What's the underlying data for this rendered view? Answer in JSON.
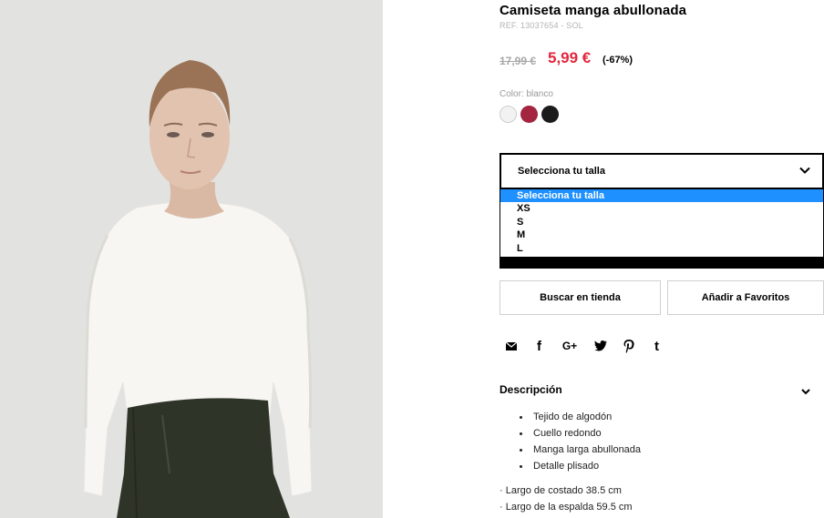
{
  "product": {
    "title": "Camiseta manga abullonada",
    "ref": "REF. 13037654 - SOL",
    "old_price": "17,99 €",
    "new_price": "5,99 €",
    "discount": "(-67%)",
    "color_label": "Color: blanco",
    "colors": [
      {
        "name": "blanco",
        "hex": "#f2f2f2"
      },
      {
        "name": "granate",
        "hex": "#a4253f"
      },
      {
        "name": "negro",
        "hex": "#1b1b1b"
      }
    ]
  },
  "size_select": {
    "value": "Selecciona tu talla",
    "options": [
      "Selecciona tu talla",
      "XS",
      "S",
      "M",
      "L"
    ],
    "highlight_color": "#1e90ff"
  },
  "actions": {
    "store_label": "Buscar en tienda",
    "favorites_label": "Añadir a Favoritos"
  },
  "share": {
    "icons": [
      "mail-icon",
      "facebook-icon",
      "google-plus-icon",
      "twitter-icon",
      "pinterest-icon",
      "tumblr-icon"
    ],
    "facebook_glyph": "f",
    "google_glyph": "G+",
    "tumblr_glyph": "t"
  },
  "description": {
    "title": "Descripción",
    "bullets": [
      "Tejido de algodón",
      "Cuello redondo",
      "Manga larga abullonada",
      "Detalle plisado"
    ],
    "measures": [
      "· Largo de costado 38.5 cm",
      "· Largo de la espalda 59.5 cm"
    ]
  },
  "colors": {
    "sale_red": "#e3263d",
    "old_price_grey": "#a8a8a8"
  }
}
